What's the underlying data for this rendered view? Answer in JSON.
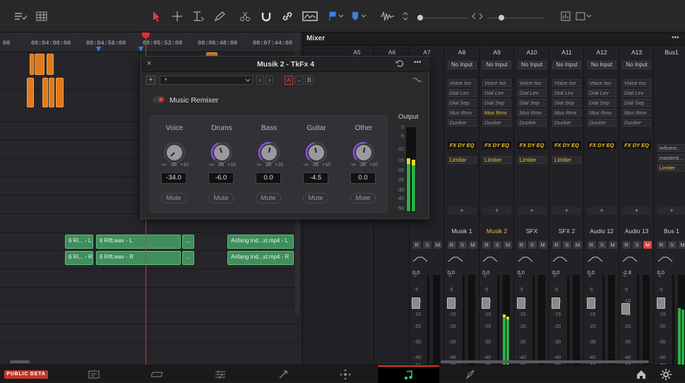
{
  "timeline": {
    "timecodes": [
      "00",
      "00:04:00:00",
      "00:04:56:00",
      "00:05:52:00",
      "00:06:48:00",
      "00:07:44:00"
    ],
    "clips": [
      {
        "label": "6 Ri... - L"
      },
      {
        "label": "6 Rift.wav - L"
      },
      {
        "label": "..."
      },
      {
        "label": "Anfang Ind...st.mp4 - L"
      },
      {
        "label": "6 Ri... - R"
      },
      {
        "label": "6 Rift.wav - R"
      },
      {
        "label": "..."
      },
      {
        "label": "Anfang Ind...st.mp4 - R"
      }
    ]
  },
  "mixer": {
    "title": "Mixer",
    "channels": [
      {
        "name": "A5",
        "input": "",
        "track": "",
        "db": "",
        "slots": [],
        "fx": "",
        "limiter": "",
        "mute_active": false
      },
      {
        "name": "A6",
        "input": "",
        "track": "",
        "db": "",
        "slots": [],
        "fx": "",
        "limiter": "",
        "mute_active": false
      },
      {
        "name": "A7",
        "input": "",
        "track": "",
        "db": "",
        "slots": [],
        "fx": "",
        "limiter": "",
        "mute_active": false
      },
      {
        "name": "A8",
        "input": "No Input",
        "track": "Musik 1",
        "db": "0.0",
        "slots": [
          "Voice Iso",
          "Dial Lev",
          "Dial Sep",
          "Mus Rmx",
          "Ducker"
        ],
        "fx": "FX DY EQ",
        "limiter": "Limiter",
        "mute_active": false
      },
      {
        "name": "A9",
        "input": "No Input",
        "track": "Musik 2",
        "db": "0.0",
        "slots": [
          "Voice Iso",
          "Dial Lev",
          "Dial Sep",
          "Mus Rmx",
          "Ducker"
        ],
        "fx": "FX DY EQ",
        "limiter": "Limiter",
        "mute_active": false
      },
      {
        "name": "A10",
        "input": "No Input",
        "track": "SFX",
        "db": "0.0",
        "slots": [
          "Voice Iso",
          "Dial Lev",
          "Dial Sep",
          "Mus Rmx",
          "Ducker"
        ],
        "fx": "FX DY EQ",
        "limiter": "Limiter",
        "mute_active": false
      },
      {
        "name": "A11",
        "input": "No Input",
        "track": "SFX 2",
        "db": "0.0",
        "slots": [
          "Voice Iso",
          "Dial Lev",
          "Dial Sep",
          "Mus Rmx",
          "Ducker"
        ],
        "fx": "FX DY EQ",
        "limiter": "Limiter",
        "mute_active": false
      },
      {
        "name": "A12",
        "input": "No Input",
        "track": "Audio 12",
        "db": "0.0",
        "slots": [
          "Voice Iso",
          "Dial Lev",
          "Dial Sep",
          "Mus Rmx",
          "Ducker"
        ],
        "fx": "FX DY EQ",
        "limiter": "",
        "mute_active": false
      },
      {
        "name": "A13",
        "input": "No Input",
        "track": "Audio 13",
        "db": "-2.8",
        "slots": [
          "Voice Iso",
          "Dial Lev",
          "Dial Sep",
          "Mus Rmx",
          "Ducker"
        ],
        "fx": "FX DY EQ",
        "limiter": "",
        "mute_active": true
      },
      {
        "name": "Bus1",
        "input": "",
        "track": "Bus 1",
        "db": "0.0",
        "slots": [],
        "fx": "",
        "limiter": "refinem...",
        "limiter2": "masterd...",
        "limiter3": "Limiter",
        "mute_active": false
      }
    ],
    "early_channels": [
      {
        "db": "0.0"
      },
      {
        "db": "0.0"
      },
      {
        "db": "0.0"
      }
    ],
    "rsm": [
      "R",
      "S",
      "M"
    ],
    "scale": [
      "0",
      "-5",
      "-10",
      "-15",
      "-20",
      "-30",
      "-40",
      "-50"
    ],
    "plus": "+"
  },
  "dialog": {
    "title": "Musik 2 - TkFx 4",
    "preset": "*",
    "ab_a": "A",
    "ab_arrow": "→",
    "ab_b": "B",
    "plugin_name": "Music Remixer",
    "output_label": "Output",
    "output_scale": [
      "0",
      "-5",
      "-10",
      "-15",
      "-20",
      "-25",
      "-30",
      "-40",
      "-50"
    ],
    "scale_minus": "-∞",
    "scale_db": "dB",
    "scale_plus": "+10",
    "mute_label": "Mute",
    "stems": [
      {
        "name": "Voice",
        "value": "-34.0"
      },
      {
        "name": "Drums",
        "value": "-6.0"
      },
      {
        "name": "Bass",
        "value": "0.0"
      },
      {
        "name": "Guitar",
        "value": "-4.5"
      },
      {
        "name": "Other",
        "value": "0.0"
      }
    ]
  },
  "bottom": {
    "beta_label": "PUBLIC BETA"
  }
}
